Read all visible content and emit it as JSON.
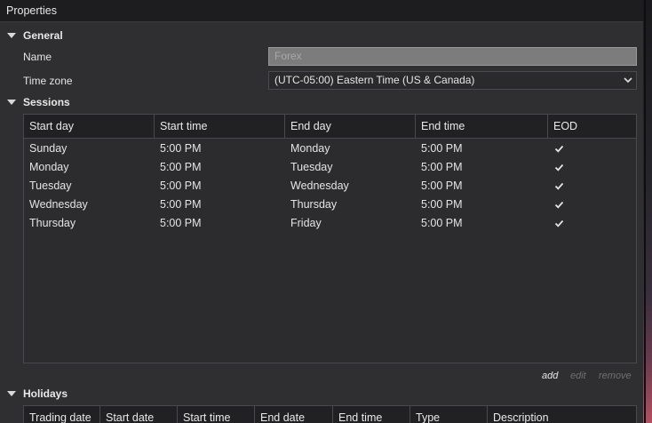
{
  "title": "Properties",
  "general": {
    "header": "General",
    "name_label": "Name",
    "name_value": "Forex",
    "timezone_label": "Time zone",
    "timezone_value": "(UTC-05:00) Eastern Time (US & Canada)"
  },
  "sessions": {
    "header": "Sessions",
    "columns": [
      "Start day",
      "Start time",
      "End day",
      "End time",
      "EOD"
    ],
    "rows": [
      {
        "start_day": "Sunday",
        "start_time": "5:00 PM",
        "end_day": "Monday",
        "end_time": "5:00 PM",
        "eod": true
      },
      {
        "start_day": "Monday",
        "start_time": "5:00 PM",
        "end_day": "Tuesday",
        "end_time": "5:00 PM",
        "eod": true
      },
      {
        "start_day": "Tuesday",
        "start_time": "5:00 PM",
        "end_day": "Wednesday",
        "end_time": "5:00 PM",
        "eod": true
      },
      {
        "start_day": "Wednesday",
        "start_time": "5:00 PM",
        "end_day": "Thursday",
        "end_time": "5:00 PM",
        "eod": true
      },
      {
        "start_day": "Thursday",
        "start_time": "5:00 PM",
        "end_day": "Friday",
        "end_time": "5:00 PM",
        "eod": true
      }
    ],
    "actions": {
      "add": "add",
      "edit": "edit",
      "remove": "remove"
    }
  },
  "holidays": {
    "header": "Holidays",
    "columns": [
      "Trading date",
      "Start date",
      "Start time",
      "End date",
      "End time",
      "Type",
      "Description"
    ]
  }
}
